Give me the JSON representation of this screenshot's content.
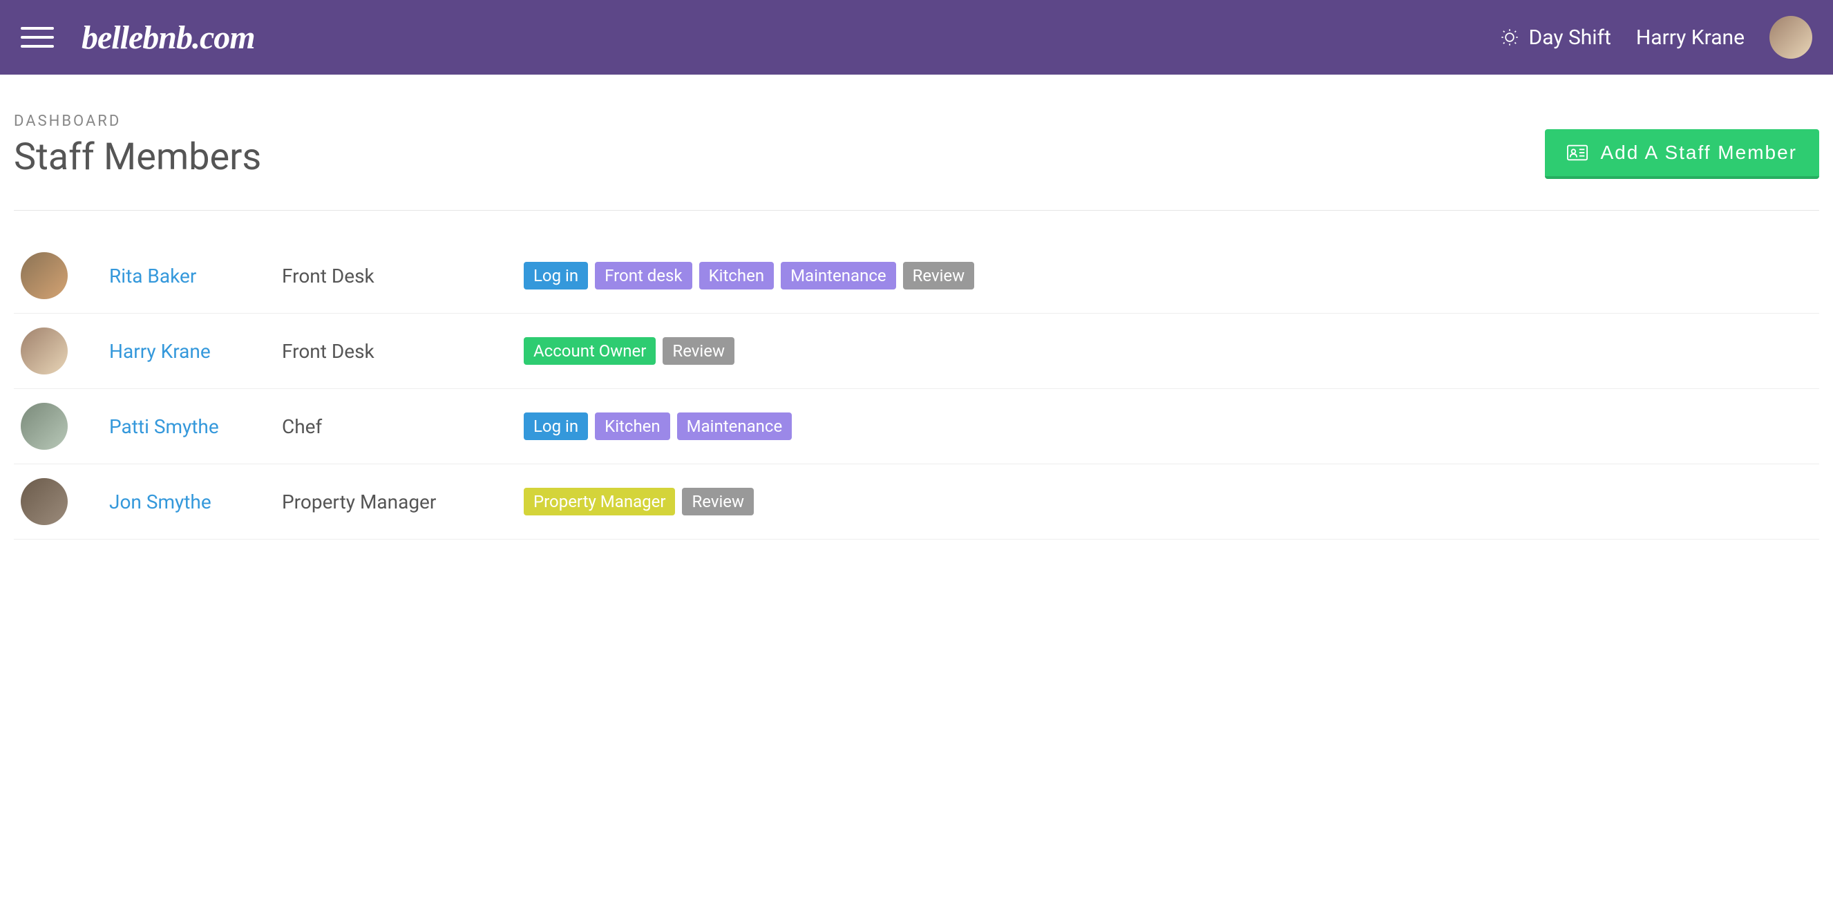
{
  "header": {
    "logo": "bellebnb.com",
    "shift_label": "Day Shift",
    "user_name": "Harry Krane"
  },
  "page": {
    "breadcrumb": "DASHBOARD",
    "title": "Staff Members",
    "add_button_label": "Add A Staff Member"
  },
  "tag_colors": {
    "Log in": "blue",
    "Front desk": "purple",
    "Kitchen": "purple",
    "Maintenance": "purple",
    "Review": "gray",
    "Account Owner": "green",
    "Property Manager": "yellow"
  },
  "staff": [
    {
      "name": "Rita Baker",
      "role": "Front Desk",
      "avatar_class": "av-1",
      "tags": [
        "Log in",
        "Front desk",
        "Kitchen",
        "Maintenance",
        "Review"
      ]
    },
    {
      "name": "Harry Krane",
      "role": "Front Desk",
      "avatar_class": "av-2",
      "tags": [
        "Account Owner",
        "Review"
      ]
    },
    {
      "name": "Patti Smythe",
      "role": "Chef",
      "avatar_class": "av-3",
      "tags": [
        "Log in",
        "Kitchen",
        "Maintenance"
      ]
    },
    {
      "name": "Jon Smythe",
      "role": "Property Manager",
      "avatar_class": "av-4",
      "tags": [
        "Property Manager",
        "Review"
      ]
    }
  ]
}
